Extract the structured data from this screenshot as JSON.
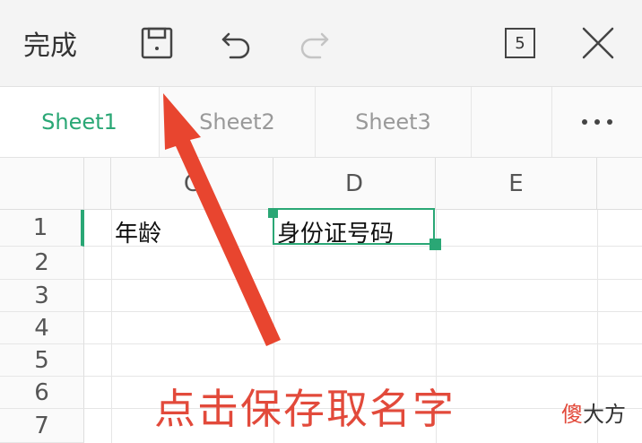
{
  "toolbar": {
    "done_label": "完成",
    "page_count": "5"
  },
  "tabs": [
    {
      "label": "Sheet1",
      "active": true
    },
    {
      "label": "Sheet2",
      "active": false
    },
    {
      "label": "Sheet3",
      "active": false
    }
  ],
  "columns": [
    "C",
    "D",
    "E"
  ],
  "rows": [
    "1",
    "2",
    "3",
    "4",
    "5",
    "6",
    "7"
  ],
  "cells": {
    "C1": "年龄",
    "D1": "身份证号码"
  },
  "selected_cell": "D1",
  "annotation": {
    "text": "点击保存取名字",
    "color": "#e24a3b"
  },
  "watermark": {
    "first_char": "傻",
    "rest": "大方"
  },
  "colors": {
    "accent": "#2aa775",
    "arrow": "#e8452f"
  }
}
